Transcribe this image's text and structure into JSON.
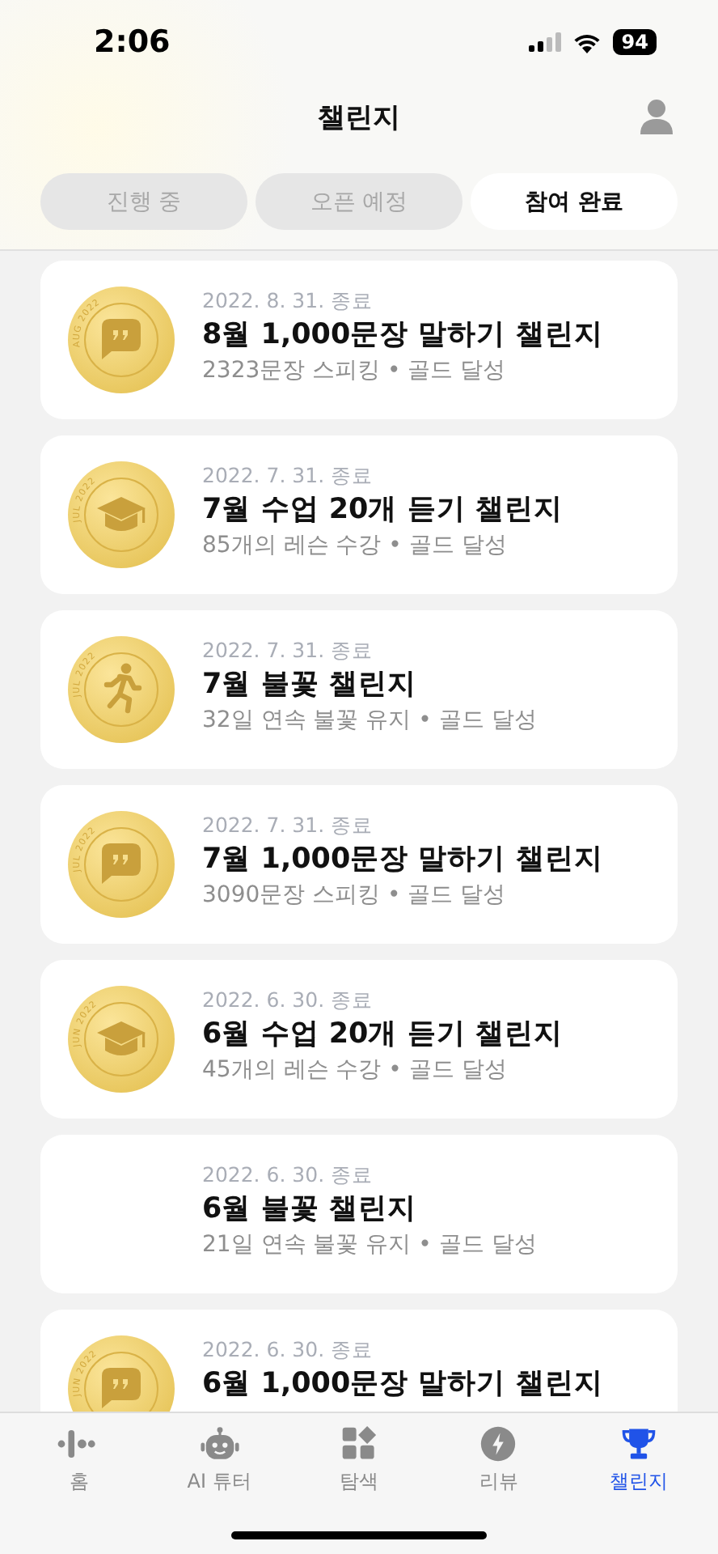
{
  "status_bar": {
    "time": "2:06",
    "battery": "94"
  },
  "header": {
    "title": "챌린지"
  },
  "tabs": [
    {
      "label": "진행 중",
      "selected": false
    },
    {
      "label": "오픈 예정",
      "selected": false
    },
    {
      "label": "참여 완료",
      "selected": true
    }
  ],
  "challenges": [
    {
      "medal": {
        "kind": "speech",
        "label": "AUG 2022"
      },
      "date": "2022. 8. 31. 종료",
      "title": "8월 1,000문장 말하기 챌린지",
      "summary": "2323문장 스피킹 • 골드 달성"
    },
    {
      "medal": {
        "kind": "cap",
        "label": "JUL 2022"
      },
      "date": "2022. 7. 31. 종료",
      "title": "7월 수업 20개 듣기 챌린지",
      "summary": "85개의 레슨 수강 • 골드 달성"
    },
    {
      "medal": {
        "kind": "runner",
        "label": "JUL 2022"
      },
      "date": "2022. 7. 31. 종료",
      "title": "7월 불꽃 챌린지",
      "summary": "32일 연속 불꽃 유지 • 골드 달성"
    },
    {
      "medal": {
        "kind": "speech",
        "label": "JUL 2022"
      },
      "date": "2022. 7. 31. 종료",
      "title": "7월 1,000문장 말하기 챌린지",
      "summary": "3090문장 스피킹 • 골드 달성"
    },
    {
      "medal": {
        "kind": "cap",
        "label": "JUN 2022"
      },
      "date": "2022. 6. 30. 종료",
      "title": "6월 수업 20개 듣기 챌린지",
      "summary": "45개의 레슨 수강 • 골드 달성"
    },
    {
      "date": "2022. 6. 30. 종료",
      "title": "6월 불꽃 챌린지",
      "summary": "21일 연속 불꽃 유지 • 골드 달성"
    },
    {
      "medal": {
        "kind": "speech",
        "label": "JUN 2022"
      },
      "date": "2022. 6. 30. 종료",
      "title": "6월 1,000문장 말하기 챌린지"
    }
  ],
  "tab_bar": [
    {
      "kind": "home",
      "label": "홈",
      "selected": false
    },
    {
      "kind": "robot",
      "label": "AI 튜터",
      "selected": false
    },
    {
      "kind": "explore",
      "label": "탐색",
      "selected": false
    },
    {
      "kind": "review",
      "label": "리뷰",
      "selected": false
    },
    {
      "kind": "trophy",
      "label": "챌린지",
      "selected": true
    }
  ]
}
